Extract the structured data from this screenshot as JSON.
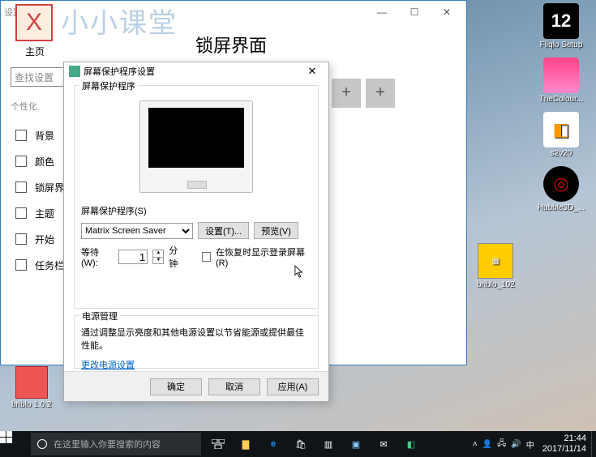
{
  "desktop": {
    "icons": [
      {
        "label": "Fliqlo Setup",
        "glyph": "12"
      },
      {
        "label": "TheColour...",
        "glyph": ""
      },
      {
        "label": "s2v20",
        "glyph": "◧"
      },
      {
        "label": "Hubble3D_...",
        "glyph": "◎"
      }
    ],
    "briblo102": "briblo_102",
    "briblo": "briblo 1.0.2"
  },
  "settings": {
    "window_label": "设置",
    "big": "小小课堂",
    "home": "主页",
    "title": "锁屏界面",
    "search_placeholder": "查找设置",
    "section": "个性化",
    "items": [
      "背景",
      "颜色",
      "锁屏界面",
      "主题",
      "开始",
      "任务栏"
    ]
  },
  "dlg": {
    "title": "屏幕保护程序设置",
    "group_screensaver": "屏幕保护程序",
    "ss_label": "屏幕保护程序(S)",
    "selected": "Matrix Screen Saver",
    "settings_btn": "设置(T)...",
    "preview_btn": "预览(V)",
    "wait_label": "等待(W):",
    "wait_value": "1",
    "minutes": "分钟",
    "resume_label": "在恢复时显示登录屏幕(R)",
    "power_group": "电源管理",
    "power_text": "通过调整显示亮度和其他电源设置以节省能源或提供最佳性能。",
    "power_link": "更改电源设置",
    "ok": "确定",
    "cancel": "取消",
    "apply": "应用(A)"
  },
  "taskbar": {
    "search": "在这里输入你要搜索的内容",
    "time": "21:44",
    "date": "2017/11/14"
  }
}
